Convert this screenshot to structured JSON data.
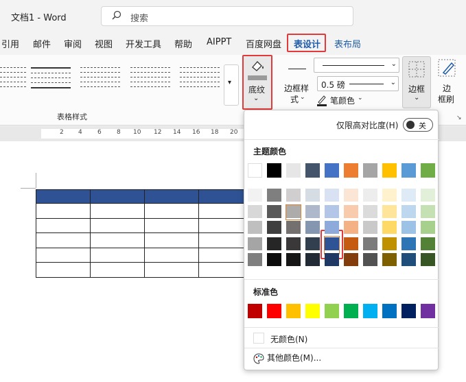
{
  "titlebar": {
    "app_title": "文档1 - Word",
    "search_placeholder": "搜索"
  },
  "tabs": [
    {
      "name": "tab-references",
      "label": "引用"
    },
    {
      "name": "tab-mailings",
      "label": "邮件"
    },
    {
      "name": "tab-review",
      "label": "审阅"
    },
    {
      "name": "tab-view",
      "label": "视图"
    },
    {
      "name": "tab-developer",
      "label": "开发工具"
    },
    {
      "name": "tab-help",
      "label": "帮助"
    },
    {
      "name": "tab-aippt",
      "label": "AIPPT"
    },
    {
      "name": "tab-baidu",
      "label": "百度网盘"
    },
    {
      "name": "tab-table-design",
      "label": "表设计"
    },
    {
      "name": "tab-layout",
      "label": "表布局"
    }
  ],
  "ribbon": {
    "table_styles_label": "表格样式",
    "shading_label": "底纹",
    "border_styles_label1": "边框样",
    "border_styles_label2": "式",
    "pen_weight_value": "0.5 磅",
    "pen_color_label": "笔颜色",
    "borders_label": "边框",
    "border_painter_label1": "边",
    "border_painter_label2": "框刷"
  },
  "ruler": {
    "ticks": [
      "2",
      "4",
      "6",
      "8",
      "10",
      "12",
      "14",
      "16",
      "18",
      "20"
    ]
  },
  "panel": {
    "high_contrast_label": "仅限高对比度(H)",
    "toggle_state": "关",
    "theme_colors_title": "主题颜色",
    "standard_colors_title": "标准色",
    "no_color_label": "无颜色(N)",
    "more_colors_label": "其他颜色(M)..."
  },
  "colors": {
    "theme_top": [
      "#ffffff",
      "#000000",
      "#e7e6e6",
      "#44546a",
      "#4472c4",
      "#ed7d31",
      "#a5a5a5",
      "#ffc000",
      "#5b9bd5",
      "#70ad47"
    ],
    "theme_shades": [
      [
        "#f2f2f2",
        "#7f7f7f",
        "#d0cece",
        "#d6dce4",
        "#d9e2f3",
        "#fbe5d5",
        "#ededed",
        "#fff2cc",
        "#deebf6",
        "#e2efd9"
      ],
      [
        "#d8d8d8",
        "#595959",
        "#aeabab",
        "#adb9ca",
        "#b4c6e7",
        "#f7cbac",
        "#dbdbdb",
        "#fee599",
        "#bdd7ee",
        "#c5e0b3"
      ],
      [
        "#bfbfbf",
        "#3f3f3f",
        "#757070",
        "#8496b0",
        "#8eaadb",
        "#f4b183",
        "#c9c9c9",
        "#ffd965",
        "#9cc3e5",
        "#a8d08d"
      ],
      [
        "#a5a5a5",
        "#262626",
        "#3a3838",
        "#323f4f",
        "#2f5496",
        "#c55a11",
        "#7b7b7b",
        "#bf9000",
        "#2e75b5",
        "#538135"
      ],
      [
        "#7f7f7f",
        "#0c0c0c",
        "#171616",
        "#222a35",
        "#1f3864",
        "#833c0b",
        "#525252",
        "#7f6000",
        "#1e4e79",
        "#375623"
      ]
    ],
    "standard": [
      "#c00000",
      "#ff0000",
      "#ffc000",
      "#ffff00",
      "#92d050",
      "#00b050",
      "#00b0f0",
      "#0070c0",
      "#002060",
      "#7030a0"
    ],
    "table_header": "#2e5294",
    "accent_blue": "#1e5ba8",
    "highlight_red": "#e23a3a"
  }
}
